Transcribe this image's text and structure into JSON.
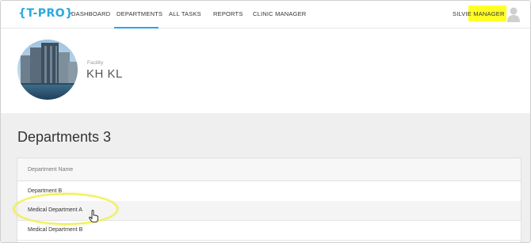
{
  "app": {
    "logo": "{T-PRO}"
  },
  "nav": {
    "items": [
      {
        "label": "DASHBOARD",
        "active": false
      },
      {
        "label": "DEPARTMENTS",
        "active": true
      },
      {
        "label": "ALL TASKS",
        "active": false
      },
      {
        "label": "REPORTS",
        "active": false
      },
      {
        "label": "CLINIC MANAGER",
        "active": false
      }
    ],
    "user": "SILVIE MANAGER"
  },
  "facility": {
    "label": "Facility",
    "name": "KH KL"
  },
  "departments": {
    "title": "Departments 3",
    "column_header": "Department Name",
    "rows": [
      "Department B",
      "Medical Department A",
      "Medical Department B"
    ]
  },
  "colors": {
    "accent": "#29a9e0",
    "highlight": "#ffff26",
    "annotation": "#f0f04a"
  },
  "icons": {
    "avatar": "user-avatar-icon",
    "cursor": "hand-pointer-icon"
  }
}
